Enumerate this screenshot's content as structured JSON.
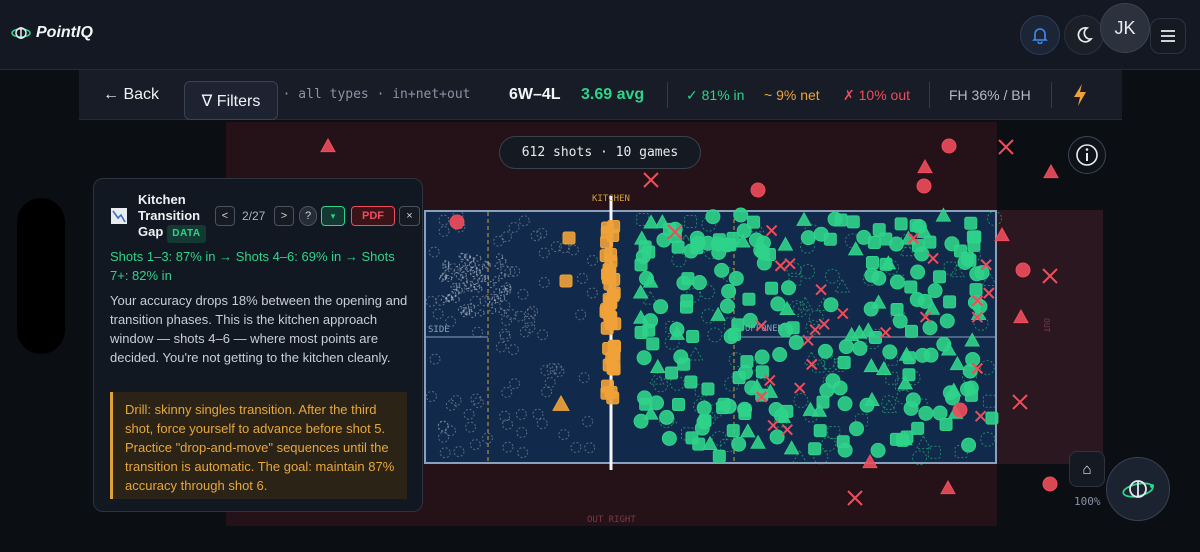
{
  "app": {
    "name": "PointIQ"
  },
  "header": {
    "avatar_initials": "JK"
  },
  "filterbar": {
    "back_label": "← Back",
    "filters_label": "∇ Filters",
    "types_hint": "s · all types · in+net+out",
    "record": "6W–4L",
    "avg": "3.69 avg",
    "pct_in": "✓ 81% in",
    "pct_net": "~ 9% net",
    "pct_out": "✗ 10% out",
    "fh_bh": "FH 36% / BH",
    "bolt_icon": "lightning-icon"
  },
  "court": {
    "summary": "612 shots · 10 games",
    "kitchen_label": "KITCHEN",
    "side_label": "SIDE",
    "opponents_label": "OPPONENTS",
    "out_right_label": "OUT RIGHT",
    "out_label": "OUT",
    "zoom": "100%",
    "home_icon": "⌂",
    "colors": {
      "in": "#2fd38a",
      "net": "#f0a23a",
      "out": "#ef4d5c"
    }
  },
  "panel": {
    "title": "Kitchen Transition Gap",
    "badge": "DATA",
    "counter": "2/27",
    "prev": "<",
    "next": ">",
    "help": "?",
    "expand": "▾",
    "pdf": "PDF",
    "close": "×",
    "stats": "Shots 1–3: 87% in → Shots 4–6: 69% in → Shots 7+: 82% in",
    "body": "Your accuracy drops 18% between the opening and transition phases. This is the kitchen approach window — shots 4–6 — where most points are decided. You're not getting to the kitchen cleanly.",
    "drill": "Drill: skinny singles transition. After the third shot, force yourself to advance before shot 5. Practice \"drop-and-move\" sequences until the transition is automatic. The goal: maintain 87% accuracy through shot 6."
  }
}
